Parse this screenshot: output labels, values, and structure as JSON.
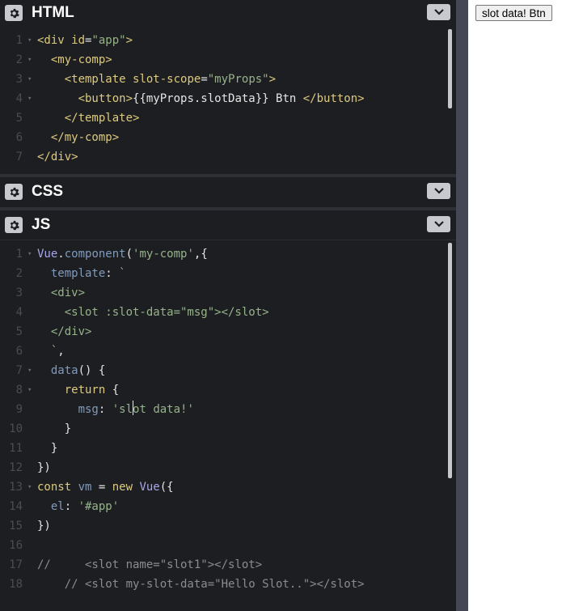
{
  "panels": {
    "html": {
      "title": "HTML"
    },
    "css": {
      "title": "CSS"
    },
    "js": {
      "title": "JS"
    }
  },
  "icons": {
    "settings": "gear-icon",
    "collapse": "chevron-down-icon"
  },
  "html_code": [
    {
      "ln": "1",
      "fold": true,
      "tokens": [
        [
          "t-tag",
          "<div "
        ],
        [
          "t-attr",
          "id"
        ],
        [
          "t-punct",
          "="
        ],
        [
          "t-str",
          "\"app\""
        ],
        [
          "t-tag",
          ">"
        ]
      ]
    },
    {
      "ln": "2",
      "fold": true,
      "tokens": [
        [
          "t-plain",
          "  "
        ],
        [
          "t-tag",
          "<my-comp>"
        ]
      ]
    },
    {
      "ln": "3",
      "fold": true,
      "tokens": [
        [
          "t-plain",
          "    "
        ],
        [
          "t-tag",
          "<template "
        ],
        [
          "t-attr",
          "slot-scope"
        ],
        [
          "t-punct",
          "="
        ],
        [
          "t-str",
          "\"myProps\""
        ],
        [
          "t-tag",
          ">"
        ]
      ]
    },
    {
      "ln": "4",
      "fold": true,
      "tokens": [
        [
          "t-plain",
          "      "
        ],
        [
          "t-tag",
          "<button>"
        ],
        [
          "t-plain",
          "{{myProps.slotData}} Btn "
        ],
        [
          "t-tag",
          "</button>"
        ]
      ]
    },
    {
      "ln": "5",
      "fold": false,
      "tokens": [
        [
          "t-plain",
          "    "
        ],
        [
          "t-tag",
          "</template>"
        ]
      ]
    },
    {
      "ln": "6",
      "fold": false,
      "tokens": [
        [
          "t-plain",
          "  "
        ],
        [
          "t-tag",
          "</my-comp>"
        ]
      ]
    },
    {
      "ln": "7",
      "fold": false,
      "tokens": [
        [
          "t-tag",
          "</div>"
        ]
      ]
    }
  ],
  "js_code": [
    {
      "ln": "1",
      "fold": true,
      "tokens": [
        [
          "t-fn",
          "Vue"
        ],
        [
          "t-punct",
          "."
        ],
        [
          "t-prop",
          "component"
        ],
        [
          "t-punct",
          "("
        ],
        [
          "t-str",
          "'my-comp'"
        ],
        [
          "t-punct",
          ",{"
        ]
      ]
    },
    {
      "ln": "2",
      "fold": false,
      "tokens": [
        [
          "t-plain",
          "  "
        ],
        [
          "t-prop",
          "template"
        ],
        [
          "t-punct",
          ": "
        ],
        [
          "t-tpl",
          "`"
        ]
      ]
    },
    {
      "ln": "3",
      "fold": false,
      "tokens": [
        [
          "t-tpl",
          "  <div>"
        ]
      ]
    },
    {
      "ln": "4",
      "fold": false,
      "tokens": [
        [
          "t-tpl",
          "    <slot :slot-data=\"msg\"></slot>"
        ]
      ]
    },
    {
      "ln": "5",
      "fold": false,
      "tokens": [
        [
          "t-tpl",
          "  </div>"
        ]
      ]
    },
    {
      "ln": "6",
      "fold": false,
      "tokens": [
        [
          "t-tpl",
          "  `"
        ],
        [
          "t-punct",
          ","
        ]
      ]
    },
    {
      "ln": "7",
      "fold": true,
      "tokens": [
        [
          "t-plain",
          "  "
        ],
        [
          "t-prop",
          "data"
        ],
        [
          "t-punct",
          "() {"
        ]
      ]
    },
    {
      "ln": "8",
      "fold": true,
      "tokens": [
        [
          "t-plain",
          "    "
        ],
        [
          "t-kw",
          "return"
        ],
        [
          "t-punct",
          " {"
        ]
      ]
    },
    {
      "ln": "9",
      "fold": false,
      "tokens": [
        [
          "t-plain",
          "      "
        ],
        [
          "t-prop",
          "msg"
        ],
        [
          "t-punct",
          ": "
        ],
        [
          "t-str",
          "'sl"
        ],
        [
          "cursor",
          ""
        ],
        [
          "t-str",
          "ot data!'"
        ]
      ]
    },
    {
      "ln": "10",
      "fold": false,
      "tokens": [
        [
          "t-plain",
          "    "
        ],
        [
          "t-punct",
          "}"
        ]
      ]
    },
    {
      "ln": "11",
      "fold": false,
      "tokens": [
        [
          "t-plain",
          "  "
        ],
        [
          "t-punct",
          "}"
        ]
      ]
    },
    {
      "ln": "12",
      "fold": false,
      "tokens": [
        [
          "t-punct",
          "})"
        ]
      ]
    },
    {
      "ln": "13",
      "fold": true,
      "tokens": [
        [
          "t-kw",
          "const "
        ],
        [
          "t-prop",
          "vm"
        ],
        [
          "t-punct",
          " = "
        ],
        [
          "t-kw",
          "new "
        ],
        [
          "t-fn",
          "Vue"
        ],
        [
          "t-punct",
          "({"
        ]
      ]
    },
    {
      "ln": "14",
      "fold": false,
      "tokens": [
        [
          "t-plain",
          "  "
        ],
        [
          "t-prop",
          "el"
        ],
        [
          "t-punct",
          ": "
        ],
        [
          "t-str",
          "'#app'"
        ]
      ]
    },
    {
      "ln": "15",
      "fold": false,
      "tokens": [
        [
          "t-punct",
          "})"
        ]
      ]
    },
    {
      "ln": "16",
      "fold": false,
      "tokens": []
    },
    {
      "ln": "17",
      "fold": false,
      "tokens": [
        [
          "t-cmt",
          "//     <slot name=\"slot1\"></slot>"
        ]
      ]
    },
    {
      "ln": "18",
      "fold": false,
      "tokens": [
        [
          "t-cmt",
          "    // <slot my-slot-data=\"Hello Slot..\"></slot>"
        ]
      ]
    }
  ],
  "preview": {
    "button_label": "slot data! Btn"
  }
}
